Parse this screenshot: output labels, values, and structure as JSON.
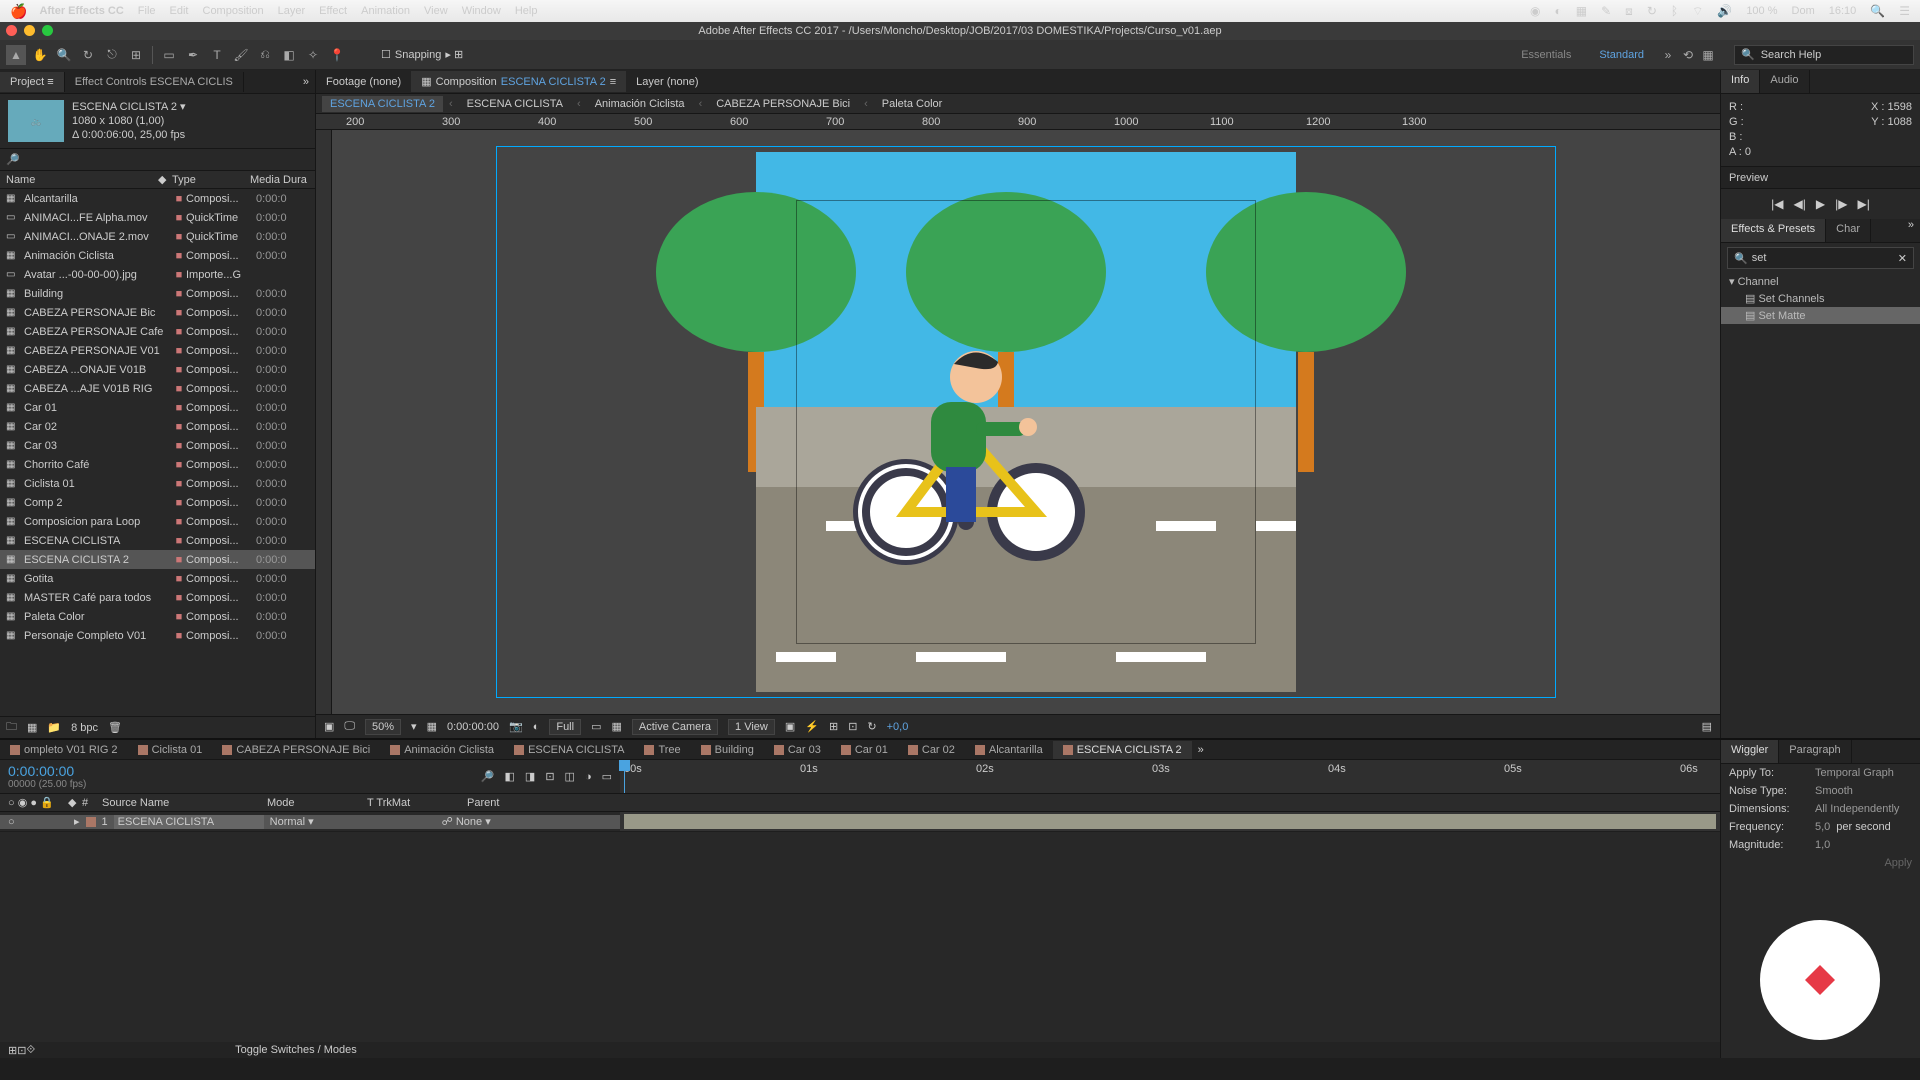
{
  "mac_menu": {
    "app": "After Effects CC",
    "items": [
      "File",
      "Edit",
      "Composition",
      "Layer",
      "Effect",
      "Animation",
      "View",
      "Window",
      "Help"
    ],
    "status": {
      "battery": "100 %",
      "day": "Dom",
      "time": "16:10"
    }
  },
  "titlebar": "Adobe After Effects CC 2017 - /Users/Moncho/Desktop/JOB/2017/03 DOMESTIKA/Projects/Curso_v01.aep",
  "toolbar": {
    "snapping": "Snapping"
  },
  "workspaces": {
    "items": [
      "Essentials",
      "Standard"
    ],
    "active": 1,
    "search_placeholder": "Search Help"
  },
  "left_panel": {
    "tabs": [
      "Project",
      "Effect Controls ESCENA CICLIS"
    ],
    "header": {
      "name": "ESCENA CICLISTA 2 ▾",
      "line2": "1080 x 1080 (1,00)",
      "line3": "Δ 0:00:06:00, 25,00 fps"
    },
    "columns": {
      "name": "Name",
      "type": "Type",
      "dur": "Media Dura"
    },
    "items": [
      {
        "i": "▦",
        "n": "Alcantarilla",
        "t": "Composi...",
        "d": "0:00:0"
      },
      {
        "i": "▭",
        "n": "ANIMACI...FE Alpha.mov",
        "t": "QuickTime",
        "d": "0:00:0"
      },
      {
        "i": "▭",
        "n": "ANIMACI...ONAJE 2.mov",
        "t": "QuickTime",
        "d": "0:00:0"
      },
      {
        "i": "▦",
        "n": "Animación Ciclista",
        "t": "Composi...",
        "d": "0:00:0"
      },
      {
        "i": "▭",
        "n": "Avatar ...-00-00-00).jpg",
        "t": "Importe...G",
        "d": ""
      },
      {
        "i": "▦",
        "n": "Building",
        "t": "Composi...",
        "d": "0:00:0"
      },
      {
        "i": "▦",
        "n": "CABEZA PERSONAJE Bic",
        "t": "Composi...",
        "d": "0:00:0"
      },
      {
        "i": "▦",
        "n": "CABEZA PERSONAJE Cafe",
        "t": "Composi...",
        "d": "0:00:0"
      },
      {
        "i": "▦",
        "n": "CABEZA PERSONAJE V01",
        "t": "Composi...",
        "d": "0:00:0"
      },
      {
        "i": "▦",
        "n": "CABEZA ...ONAJE V01B",
        "t": "Composi...",
        "d": "0:00:0"
      },
      {
        "i": "▦",
        "n": "CABEZA ...AJE V01B RIG",
        "t": "Composi...",
        "d": "0:00:0"
      },
      {
        "i": "▦",
        "n": "Car 01",
        "t": "Composi...",
        "d": "0:00:0"
      },
      {
        "i": "▦",
        "n": "Car 02",
        "t": "Composi...",
        "d": "0:00:0"
      },
      {
        "i": "▦",
        "n": "Car 03",
        "t": "Composi...",
        "d": "0:00:0"
      },
      {
        "i": "▦",
        "n": "Chorrito Café",
        "t": "Composi...",
        "d": "0:00:0"
      },
      {
        "i": "▦",
        "n": "Ciclista 01",
        "t": "Composi...",
        "d": "0:00:0"
      },
      {
        "i": "▦",
        "n": "Comp 2",
        "t": "Composi...",
        "d": "0:00:0"
      },
      {
        "i": "▦",
        "n": "Composicion para Loop",
        "t": "Composi...",
        "d": "0:00:0"
      },
      {
        "i": "▦",
        "n": "ESCENA CICLISTA",
        "t": "Composi...",
        "d": "0:00:0"
      },
      {
        "i": "▦",
        "n": "ESCENA CICLISTA 2",
        "t": "Composi...",
        "d": "0:00:0",
        "sel": true
      },
      {
        "i": "▦",
        "n": "Gotita",
        "t": "Composi...",
        "d": "0:00:0"
      },
      {
        "i": "▦",
        "n": "MASTER Café para todos",
        "t": "Composi...",
        "d": "0:00:0"
      },
      {
        "i": "▦",
        "n": "Paleta Color",
        "t": "Composi...",
        "d": "0:00:0"
      },
      {
        "i": "▦",
        "n": "Personaje Completo V01",
        "t": "Composi...",
        "d": "0:00:0"
      }
    ],
    "footer": {
      "bpc": "8 bpc"
    }
  },
  "center": {
    "tabs": [
      {
        "l": "Footage (none)"
      },
      {
        "l": "Composition",
        "b": "ESCENA CICLISTA 2",
        "active": true
      },
      {
        "l": "Layer (none)"
      }
    ],
    "breadcrumb": [
      "ESCENA CICLISTA 2",
      "ESCENA CICLISTA",
      "Animación Ciclista",
      "CABEZA PERSONAJE Bici",
      "Paleta Color"
    ],
    "ruler_marks": [
      "200",
      "300",
      "400",
      "500",
      "600",
      "700",
      "800",
      "900",
      "1000",
      "1100",
      "1200",
      "1300"
    ],
    "footer": {
      "mag": "50%",
      "time": "0:00:00:00",
      "res": "Full",
      "cam": "Active Camera",
      "view": "1 View",
      "exp": "+0,0"
    }
  },
  "right": {
    "info_tabs": [
      "Info",
      "Audio"
    ],
    "info": {
      "r": "R :",
      "g": "G :",
      "b": "B :",
      "a": "A : 0",
      "x": "X : 1598",
      "y": "Y : 1088"
    },
    "preview": "Preview",
    "ep_tabs": [
      "Effects & Presets",
      "Char"
    ],
    "ep_search": "set",
    "ep_items": [
      {
        "l": "▾ Channel",
        "ind": 0
      },
      {
        "l": "Set Channels",
        "ind": 1
      },
      {
        "l": "Set Matte",
        "ind": 1,
        "sel": true
      }
    ]
  },
  "timeline": {
    "tabs": [
      "ompleto V01 RIG 2",
      "Ciclista 01",
      "CABEZA PERSONAJE Bici",
      "Animación Ciclista",
      "ESCENA CICLISTA",
      "Tree",
      "Building",
      "Car 03",
      "Car 01",
      "Car 02",
      "Alcantarilla",
      "ESCENA CICLISTA 2"
    ],
    "active_tab": 11,
    "timecode": "0:00:00:00",
    "sub": "00000 (25.00 fps)",
    "ruler": [
      "00s",
      "01s",
      "02s",
      "03s",
      "04s",
      "05s",
      "06s"
    ],
    "cols": {
      "num": "#",
      "src": "Source Name",
      "mode": "Mode",
      "trk": "T  TrkMat",
      "parent": "Parent"
    },
    "layer": {
      "num": "1",
      "name": "ESCENA CICLISTA",
      "mode": "Normal",
      "parent": "None"
    },
    "footer": "Toggle Switches / Modes"
  },
  "wiggler": {
    "tabs": [
      "Wiggler",
      "Paragraph"
    ],
    "rows": [
      {
        "l": "Apply To:",
        "v": "Temporal Graph"
      },
      {
        "l": "Noise Type:",
        "v": "Smooth"
      },
      {
        "l": "Dimensions:",
        "v": "All Independently"
      },
      {
        "l": "Frequency:",
        "v": "5,0",
        "u": "per second"
      },
      {
        "l": "Magnitude:",
        "v": "1,0"
      }
    ],
    "apply": "Apply"
  }
}
